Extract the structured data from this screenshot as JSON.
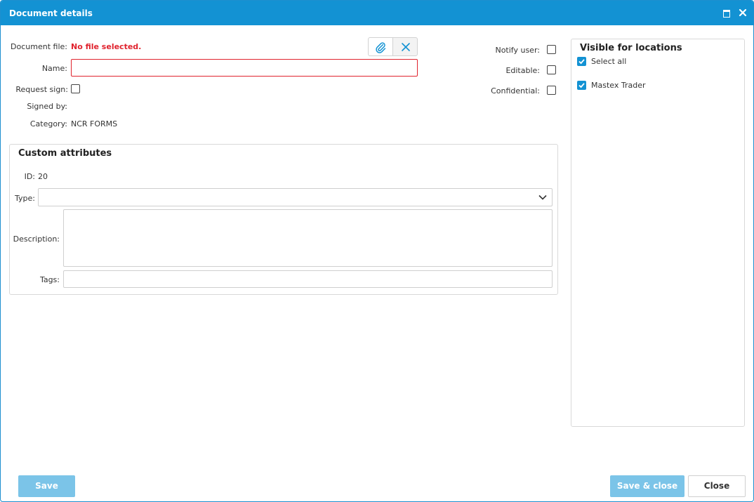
{
  "window": {
    "title": "Document details"
  },
  "document": {
    "file_label": "Document file:",
    "file_value": "No file selected.",
    "name_label": "Name:",
    "name_value": "",
    "request_sign_label": "Request sign:",
    "request_sign_checked": false,
    "signed_by_label": "Signed by:",
    "signed_by_value": "",
    "category_label": "Category:",
    "category_value": "NCR FORMS"
  },
  "flags": {
    "notify_label": "Notify user:",
    "notify_checked": false,
    "editable_label": "Editable:",
    "editable_checked": false,
    "confidential_label": "Confidential:",
    "confidential_checked": false
  },
  "custom": {
    "title": "Custom attributes",
    "id_label": "ID:",
    "id_value": "20",
    "type_label": "Type:",
    "type_value": "",
    "description_label": "Description:",
    "description_value": "",
    "tags_label": "Tags:",
    "tags_value": ""
  },
  "locations": {
    "title": "Visible for locations",
    "items": [
      {
        "label": "Select all",
        "checked": true
      },
      {
        "label": "Mastex Trader",
        "checked": true
      }
    ]
  },
  "footer": {
    "save_label": "Save",
    "save_close_label": "Save & close",
    "close_label": "Close"
  },
  "icons": {
    "attach": "paperclip-icon",
    "clear": "close-icon",
    "dropdown": "chevron-down-icon",
    "maximize": "maximize-icon",
    "window_close": "close-icon"
  },
  "colors": {
    "accent": "#1392d3",
    "error": "#e0232e",
    "primary_button": "#7bc4e8"
  }
}
